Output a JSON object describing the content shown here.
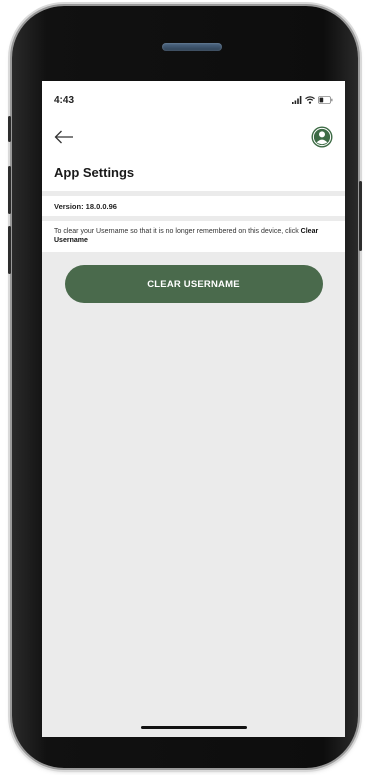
{
  "status_bar": {
    "time": "4:43"
  },
  "nav": {
    "back_icon": "arrow-left-icon",
    "profile_icon": "user-circle-icon"
  },
  "page": {
    "title": "App Settings"
  },
  "version": {
    "text": "Version: 18.0.0.96"
  },
  "info": {
    "text_before": "To clear your Username so that it is no longer remembered on this device, click ",
    "text_bold": "Clear Username"
  },
  "actions": {
    "clear_username_label": "CLEAR USERNAME"
  },
  "colors": {
    "accent": "#4a6a4c",
    "profile_icon": "#3d6b45",
    "background": "#ebebeb"
  }
}
